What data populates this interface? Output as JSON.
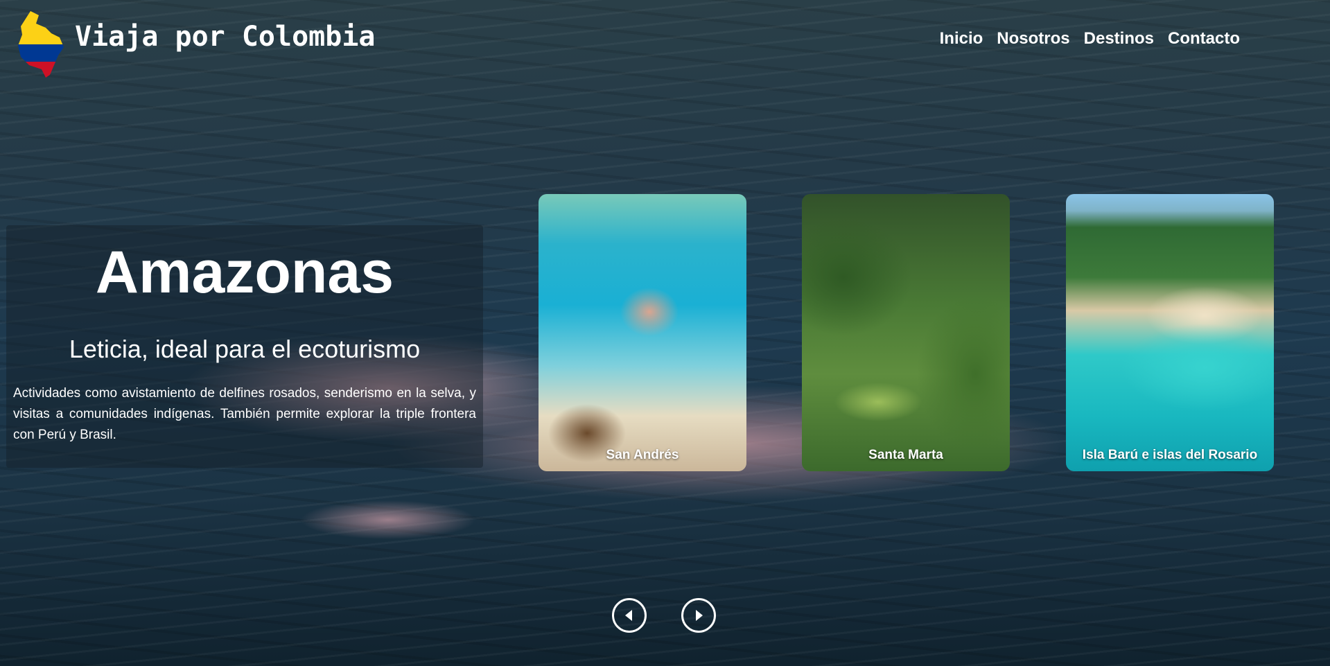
{
  "header": {
    "brand": "Viaja por Colombia",
    "nav": [
      "Inicio",
      "Nosotros",
      "Destinos",
      "Contacto"
    ]
  },
  "featured": {
    "title": "Amazonas",
    "subtitle": "Leticia, ideal para el ecoturismo",
    "description": "Actividades como avistamiento de delfines rosados, senderismo en la selva, y visitas a comunidades indígenas. También permite explorar la triple frontera con Perú y Brasil."
  },
  "destinations": [
    {
      "label": "San Andrés"
    },
    {
      "label": "Santa Marta"
    },
    {
      "label": "Isla Barú e islas del Rosario"
    }
  ],
  "controls": {
    "prev_icon": "caret-left-icon",
    "next_icon": "caret-right-icon"
  },
  "colors": {
    "flag_yellow": "#FCD116",
    "flag_blue": "#003893",
    "flag_red": "#CE1126"
  }
}
